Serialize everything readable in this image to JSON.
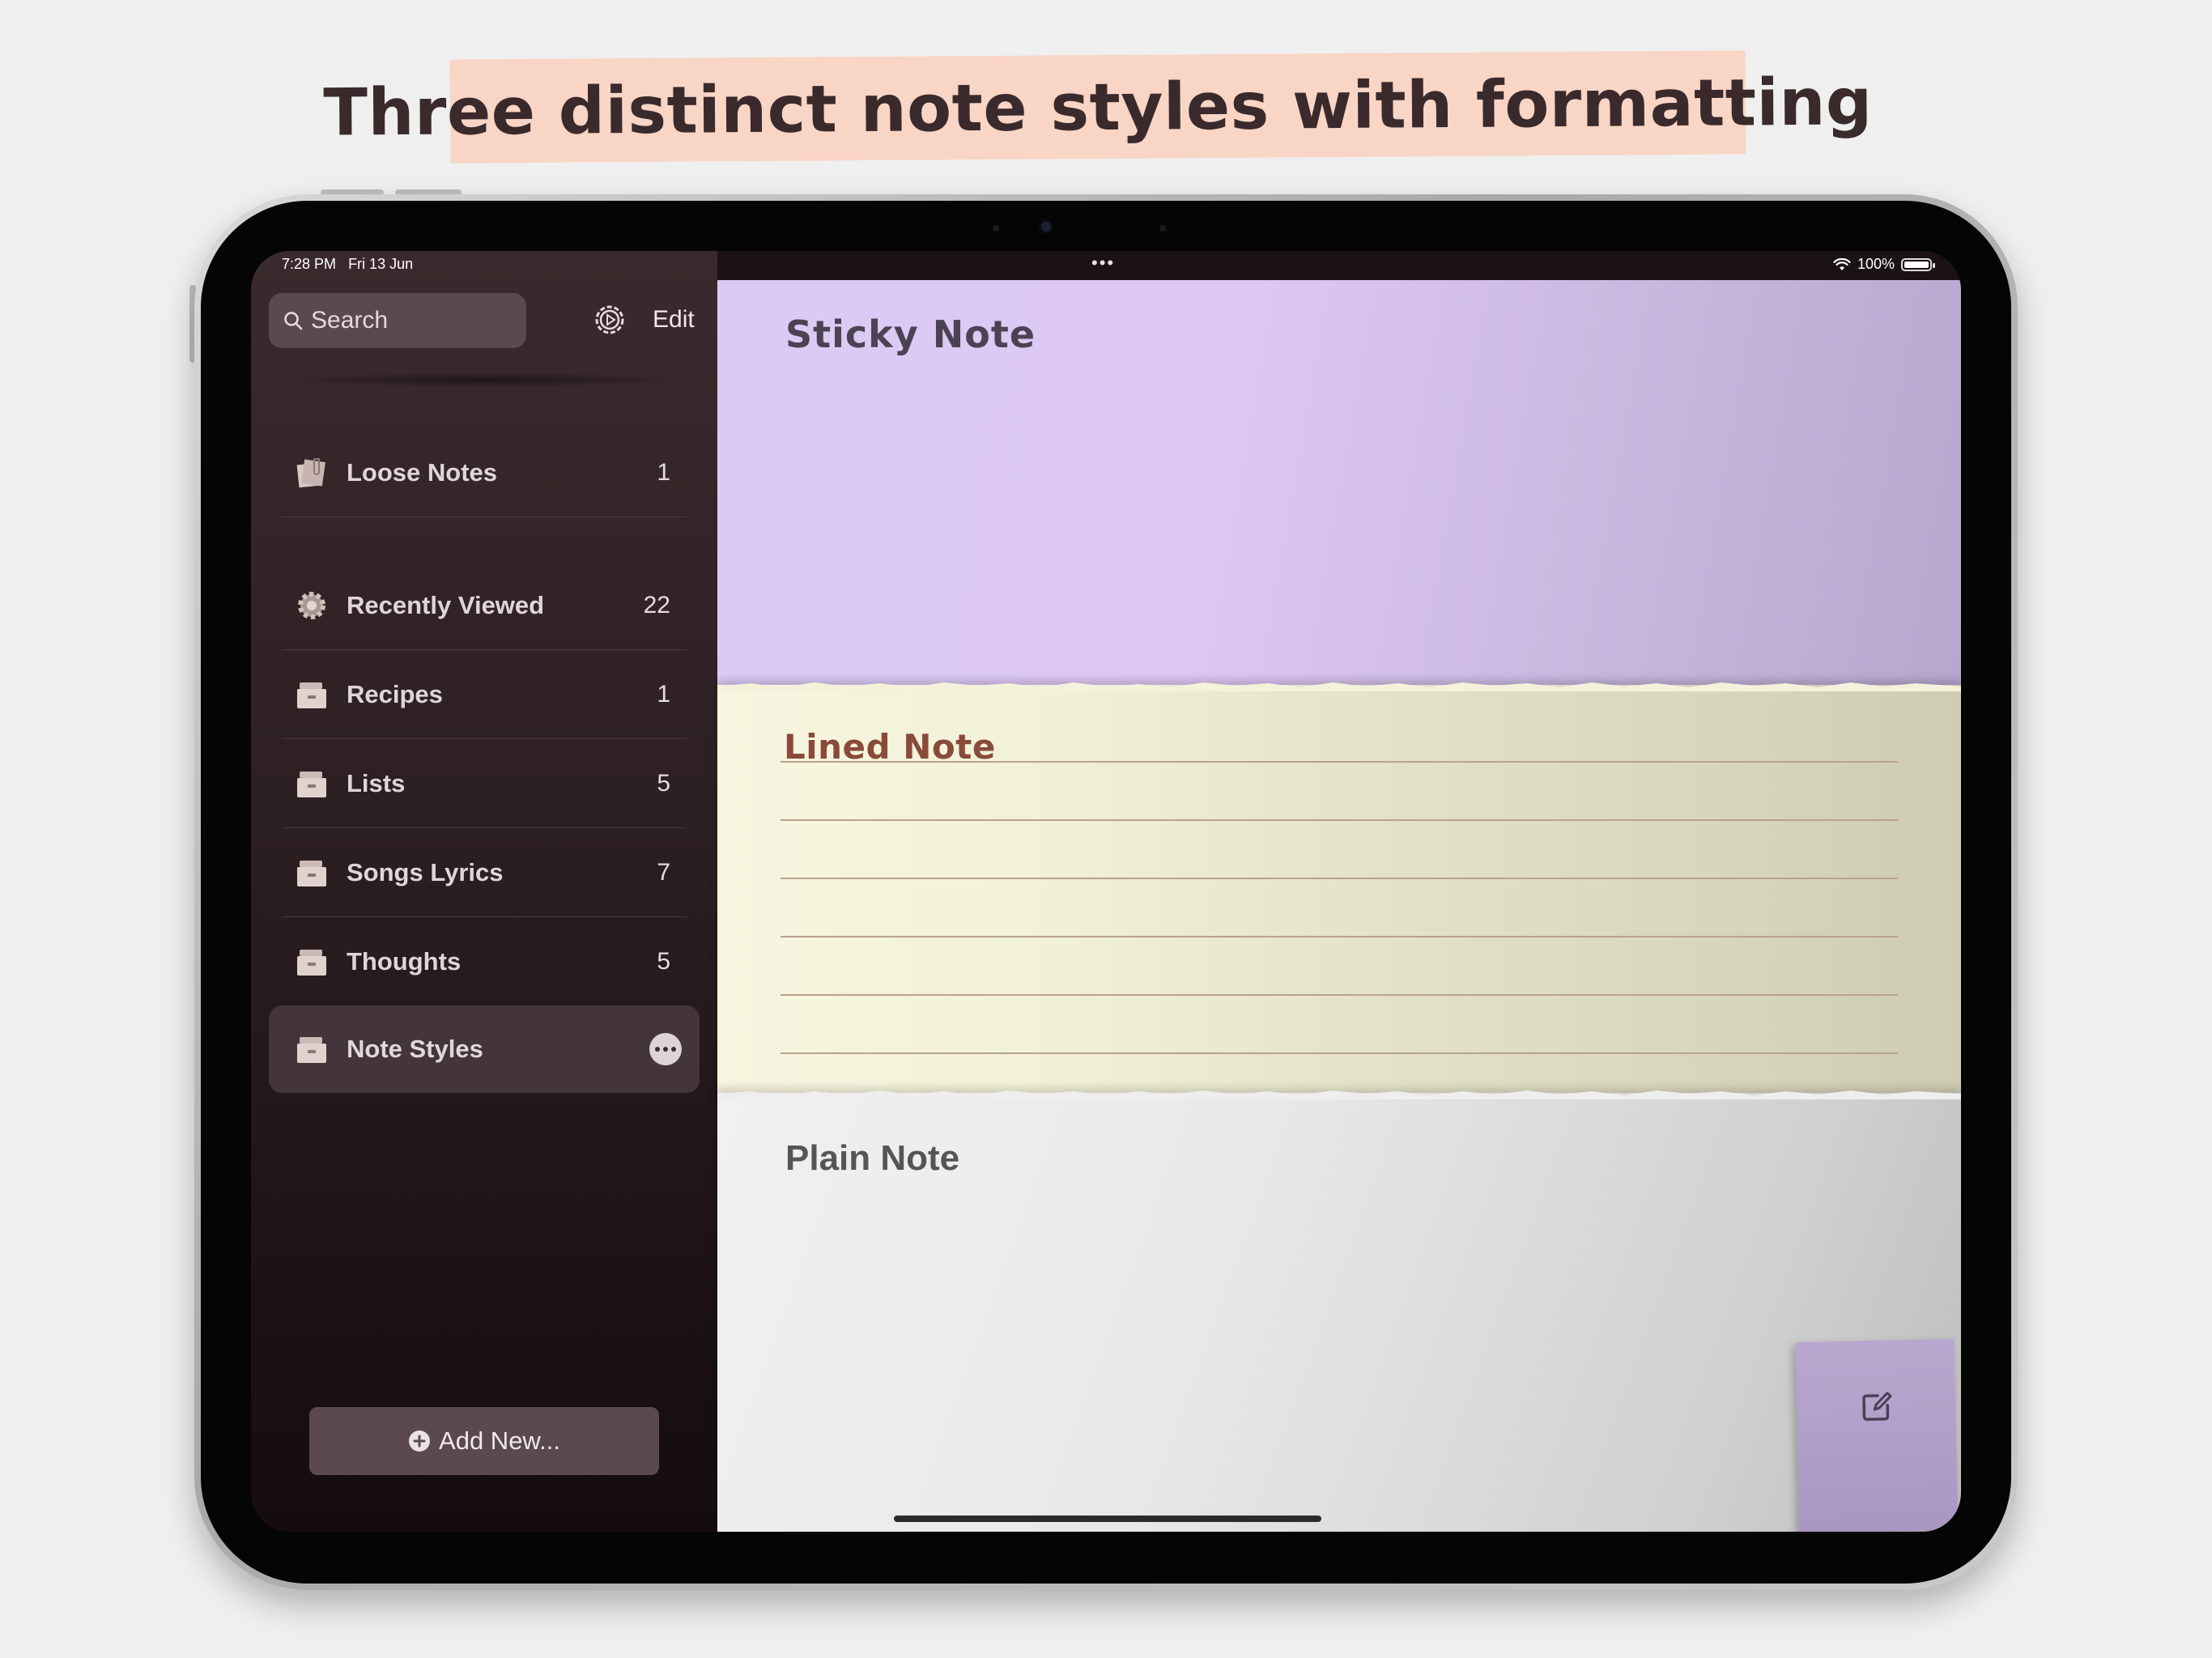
{
  "banner": {
    "text": "Three distinct note styles with formatting"
  },
  "status_bar": {
    "time": "7:28 PM",
    "date": "Fri 13 Jun",
    "battery": "100%"
  },
  "sidebar": {
    "search_placeholder": "Search",
    "edit_label": "Edit",
    "folders": [
      {
        "label": "Loose Notes",
        "count": "1",
        "icon": "loose-notes-icon"
      },
      {
        "label": "Recently Viewed",
        "count": "22",
        "icon": "gear-icon"
      },
      {
        "label": "Recipes",
        "count": "1",
        "icon": "drawer-icon"
      },
      {
        "label": "Lists",
        "count": "5",
        "icon": "drawer-icon"
      },
      {
        "label": "Songs Lyrics",
        "count": "7",
        "icon": "drawer-icon"
      },
      {
        "label": "Thoughts",
        "count": "5",
        "icon": "drawer-icon"
      },
      {
        "label": "Note Styles",
        "count": "",
        "icon": "drawer-icon",
        "selected": true
      }
    ],
    "add_label": "Add New..."
  },
  "notes": {
    "sticky": {
      "title": "Sticky Note",
      "color": "#dccaf5"
    },
    "lined": {
      "title": "Lined Note",
      "color": "#f4f2da"
    },
    "plain": {
      "title": "Plain Note",
      "color": "#e8e8e8"
    }
  },
  "colors": {
    "accent": "#f9d5c5",
    "sidebar": "#2c1f22",
    "compose": "#b9a7d0"
  }
}
